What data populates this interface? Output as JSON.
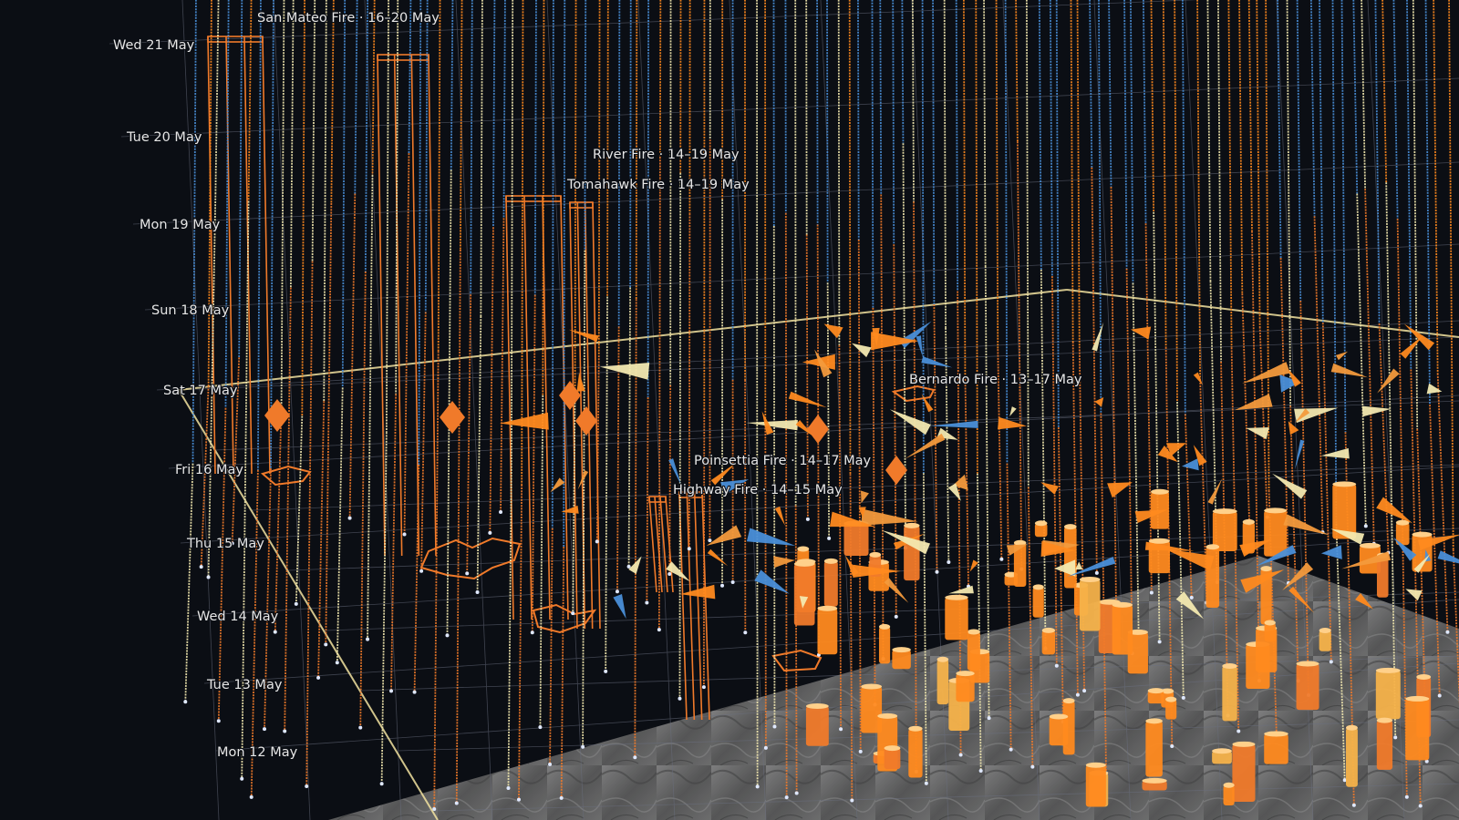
{
  "time_axis": {
    "labels": [
      "Wed 21 May",
      "Tue 20 May",
      "Mon 19 May",
      "Sun 18 May",
      "Sat 17 May",
      "Fri 16 May",
      "Thu 15 May",
      "Wed 14 May",
      "Tue 13 May",
      "Mon 12 May"
    ]
  },
  "fires": [
    {
      "label": "San Mateo Fire · 16–20 May"
    },
    {
      "label": "River Fire · 14–19 May"
    },
    {
      "label": "Tomahawk Fire · 14–19 May"
    },
    {
      "label": "Bernardo Fire · 13–17 May"
    },
    {
      "label": "Poinsettia Fire · 14–17 May"
    },
    {
      "label": "Highway Fire · 14–15 May"
    }
  ],
  "colors": {
    "background": "#0b0e14",
    "grid": "#6b7080",
    "frame": "#f3e3a0",
    "fire_orange": "#f07a2a",
    "hot_orange": "#ff8a1f",
    "cold_blue": "#4a8fd8",
    "pale_yellow": "#f3e9b0",
    "terrain": "#6a6a6a"
  }
}
